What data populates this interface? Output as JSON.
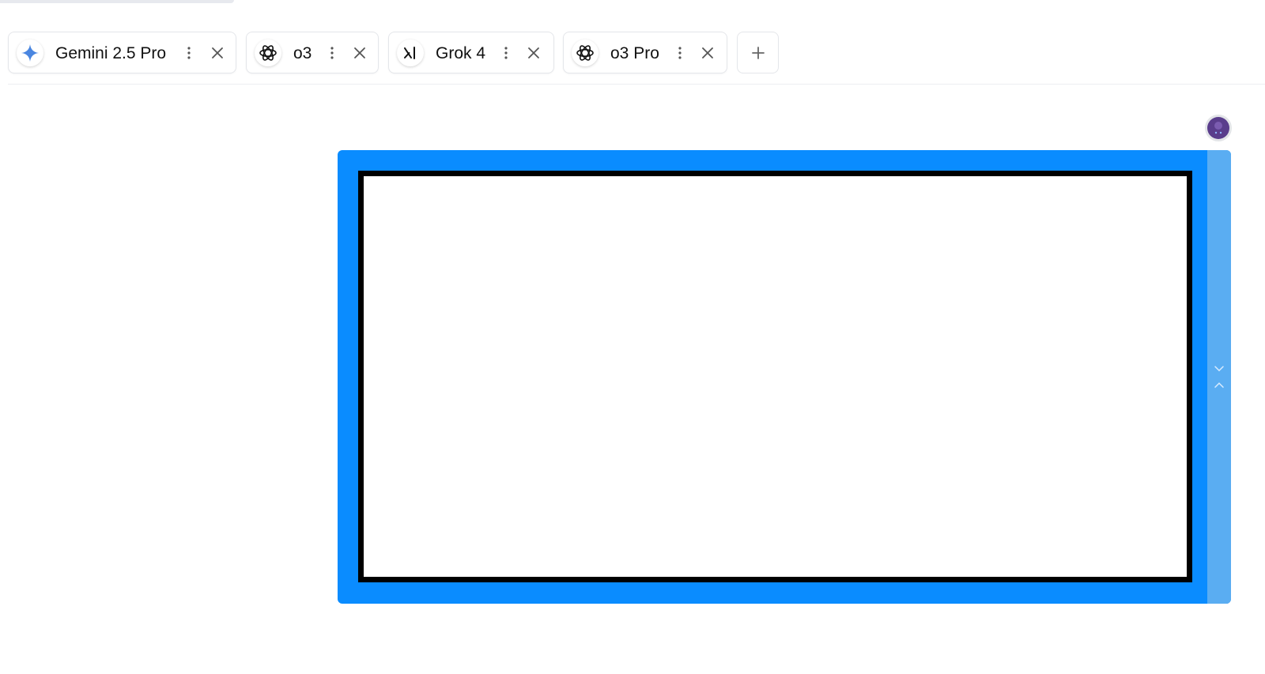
{
  "tabs": [
    {
      "label": "Gemini 2.5 Pro",
      "icon": "gemini-sparkle-icon"
    },
    {
      "label": "o3",
      "icon": "openai-logo-icon"
    },
    {
      "label": "Grok 4",
      "icon": "xai-logo-icon"
    },
    {
      "label": "o3 Pro",
      "icon": "openai-logo-icon"
    }
  ],
  "icons": {
    "menu": "vertical-dots-icon",
    "close": "close-icon",
    "add": "plus-icon",
    "avatar": "user-avatar",
    "scroll_down": "chevron-down-icon",
    "scroll_up": "chevron-up-icon"
  },
  "colors": {
    "frame_blue": "#0a8cff",
    "rail_blue": "#5aadf2",
    "gemini_blue": "#4a86e0",
    "avatar_purple": "#5a3d8c"
  }
}
